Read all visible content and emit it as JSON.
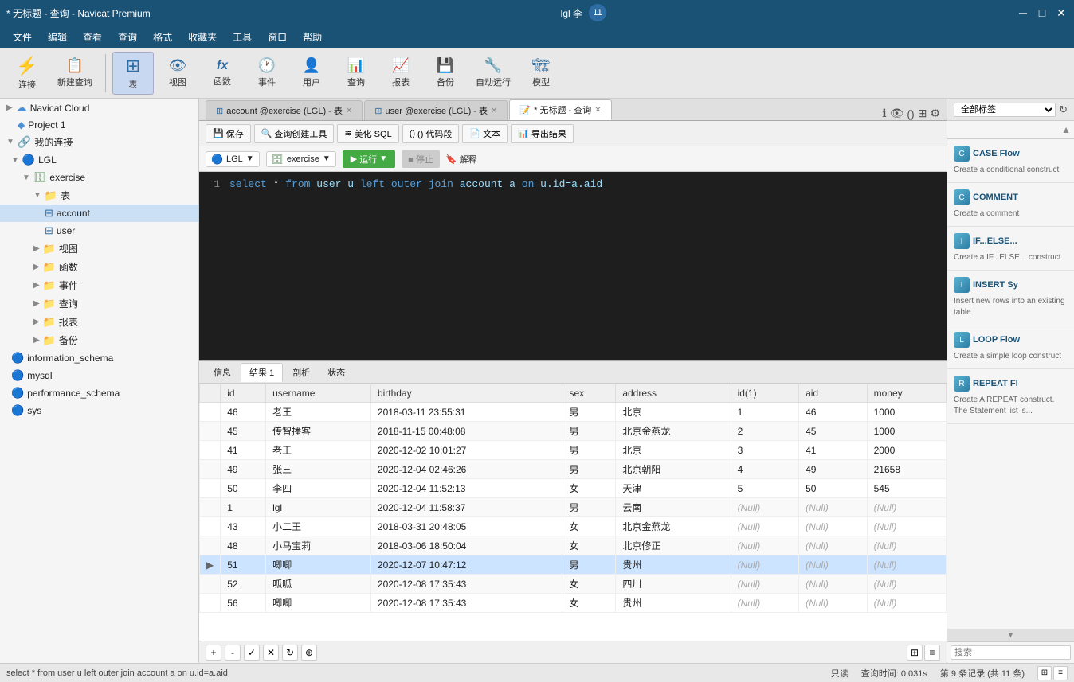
{
  "titleBar": {
    "title": "* 无标题 - 查询 - Navicat Premium",
    "minimizeBtn": "─",
    "maximizeBtn": "□",
    "closeBtn": "✕"
  },
  "menuBar": {
    "items": [
      "文件",
      "编辑",
      "查看",
      "查询",
      "格式",
      "收藏夹",
      "工具",
      "窗口",
      "帮助"
    ]
  },
  "toolbar": {
    "items": [
      {
        "id": "connect",
        "icon": "⚡",
        "label": "连接"
      },
      {
        "id": "new-query",
        "icon": "📋",
        "label": "新建查询"
      },
      {
        "id": "table",
        "icon": "⊞",
        "label": "表",
        "active": true
      },
      {
        "id": "view",
        "icon": "👁",
        "label": "视图"
      },
      {
        "id": "function",
        "icon": "fx",
        "label": "函数"
      },
      {
        "id": "event",
        "icon": "🕐",
        "label": "事件"
      },
      {
        "id": "user",
        "icon": "👤",
        "label": "用户"
      },
      {
        "id": "query",
        "icon": "📊",
        "label": "查询"
      },
      {
        "id": "report",
        "icon": "📈",
        "label": "报表"
      },
      {
        "id": "backup",
        "icon": "💾",
        "label": "备份"
      },
      {
        "id": "autorun",
        "icon": "🔧",
        "label": "自动运行"
      },
      {
        "id": "model",
        "icon": "🏗",
        "label": "模型"
      }
    ]
  },
  "sidebar": {
    "header": "Navicat Cloud",
    "items": [
      {
        "level": 0,
        "icon": "▶",
        "type": "cloud",
        "label": "Navicat Cloud",
        "expanded": true
      },
      {
        "level": 1,
        "icon": "◆",
        "type": "project",
        "label": "Project 1"
      },
      {
        "level": 0,
        "icon": "▼",
        "type": "connection",
        "label": "我的连接",
        "expanded": true
      },
      {
        "level": 1,
        "icon": "▼",
        "type": "db",
        "label": "LGL",
        "expanded": true
      },
      {
        "level": 2,
        "icon": "▼",
        "type": "db",
        "label": "exercise",
        "expanded": true
      },
      {
        "level": 3,
        "icon": "▼",
        "type": "folder",
        "label": "表",
        "expanded": true
      },
      {
        "level": 4,
        "icon": "⊞",
        "type": "table",
        "label": "account",
        "selected": true
      },
      {
        "level": 4,
        "icon": "⊞",
        "type": "table",
        "label": "user"
      },
      {
        "level": 3,
        "icon": "▶",
        "type": "folder",
        "label": "视图"
      },
      {
        "level": 3,
        "icon": "▶",
        "type": "folder",
        "label": "函数"
      },
      {
        "level": 3,
        "icon": "▶",
        "type": "folder",
        "label": "事件"
      },
      {
        "level": 3,
        "icon": "▶",
        "type": "folder",
        "label": "查询"
      },
      {
        "level": 3,
        "icon": "▶",
        "type": "folder",
        "label": "报表"
      },
      {
        "level": 3,
        "icon": "▶",
        "type": "folder",
        "label": "备份"
      },
      {
        "level": 1,
        "icon": "🔵",
        "type": "db",
        "label": "information_schema"
      },
      {
        "level": 1,
        "icon": "🔵",
        "type": "db",
        "label": "mysql"
      },
      {
        "level": 1,
        "icon": "🔵",
        "type": "db",
        "label": "performance_schema"
      },
      {
        "level": 1,
        "icon": "🔵",
        "type": "db",
        "label": "sys"
      }
    ]
  },
  "tabs": [
    {
      "id": "account-tab",
      "icon": "⊞",
      "label": "account @exercise (LGL) - 表",
      "active": false
    },
    {
      "id": "user-tab",
      "icon": "⊞",
      "label": "user @exercise (LGL) - 表",
      "active": false
    },
    {
      "id": "query-tab",
      "icon": "📝",
      "label": "* 无标题 - 查询",
      "active": true
    }
  ],
  "queryToolbar": {
    "saveBtn": "保存",
    "queryCreateBtn": "查询创建工具",
    "beautifyBtn": "美化 SQL",
    "codeBlockBtn": "() 代码段",
    "textBtn": "文本",
    "exportBtn": "导出结果"
  },
  "selectors": {
    "connection": "LGL",
    "database": "exercise",
    "runBtn": "▶ 运行",
    "stopBtn": "■ 停止",
    "explainBtn": "解释"
  },
  "sqlEditor": {
    "lineNumber": "1",
    "code": "select * from user u left outer join account a on u.id=a.aid"
  },
  "resultTabs": {
    "tabs": [
      "信息",
      "结果 1",
      "剖析",
      "状态"
    ],
    "activeTab": "结果 1"
  },
  "resultTable": {
    "columns": [
      "",
      "id",
      "username",
      "birthday",
      "sex",
      "address",
      "id(1)",
      "aid",
      "money"
    ],
    "rows": [
      {
        "indicator": "",
        "id": "46",
        "username": "老王",
        "birthday": "2018-03-11 23:55:31",
        "sex": "男",
        "address": "北京",
        "id1": "1",
        "aid": "46",
        "money": "1000"
      },
      {
        "indicator": "",
        "id": "45",
        "username": "传智播客",
        "birthday": "2018-11-15 00:48:08",
        "sex": "男",
        "address": "北京金燕龙",
        "id1": "2",
        "aid": "45",
        "money": "1000"
      },
      {
        "indicator": "",
        "id": "41",
        "username": "老王",
        "birthday": "2020-12-02 10:01:27",
        "sex": "男",
        "address": "北京",
        "id1": "3",
        "aid": "41",
        "money": "2000"
      },
      {
        "indicator": "",
        "id": "49",
        "username": "张三",
        "birthday": "2020-12-04 02:46:26",
        "sex": "男",
        "address": "北京朝阳",
        "id1": "4",
        "aid": "49",
        "money": "21658"
      },
      {
        "indicator": "",
        "id": "50",
        "username": "李四",
        "birthday": "2020-12-04 11:52:13",
        "sex": "女",
        "address": "天津",
        "id1": "5",
        "aid": "50",
        "money": "545"
      },
      {
        "indicator": "",
        "id": "1",
        "username": "lgl",
        "birthday": "2020-12-04 11:58:37",
        "sex": "男",
        "address": "云南",
        "id1": "(Null)",
        "aid": "(Null)",
        "money": "(Null)"
      },
      {
        "indicator": "",
        "id": "43",
        "username": "小二王",
        "birthday": "2018-03-31 20:48:05",
        "sex": "女",
        "address": "北京金燕龙",
        "id1": "(Null)",
        "aid": "(Null)",
        "money": "(Null)"
      },
      {
        "indicator": "",
        "id": "48",
        "username": "小马宝莉",
        "birthday": "2018-03-06 18:50:04",
        "sex": "女",
        "address": "北京修正",
        "id1": "(Null)",
        "aid": "(Null)",
        "money": "(Null)"
      },
      {
        "indicator": "▶",
        "id": "51",
        "username": "唧唧",
        "birthday": "2020-12-07 10:47:12",
        "sex": "男",
        "address": "贵州",
        "id1": "(Null)",
        "aid": "(Null)",
        "money": "(Null)"
      },
      {
        "indicator": "",
        "id": "52",
        "username": "呱呱",
        "birthday": "2020-12-08 17:35:43",
        "sex": "女",
        "address": "四川",
        "id1": "(Null)",
        "aid": "(Null)",
        "money": "(Null)"
      },
      {
        "indicator": "",
        "id": "56",
        "username": "唧唧",
        "birthday": "2020-12-08 17:35:43",
        "sex": "女",
        "address": "贵州",
        "id1": "(Null)",
        "aid": "(Null)",
        "money": "(Null)"
      }
    ]
  },
  "statusBar": {
    "sql": "select * from user u left outer join account a on u.id=a.aid",
    "mode": "只读",
    "queryTime": "查询时间: 0.031s",
    "records": "第 9 条记录 (共 11 条)"
  },
  "rightPanel": {
    "selectorLabel": "全部标签",
    "searchPlaceholder": "搜索",
    "flowItems": [
      {
        "id": "case-flow",
        "title": "CASE Flow",
        "desc": "Create a conditional construct"
      },
      {
        "id": "comment",
        "title": "COMMENT",
        "desc": "Create a comment"
      },
      {
        "id": "if-else",
        "title": "IF...ELSE...",
        "desc": "Create a IF...ELSE... construct"
      },
      {
        "id": "insert-sy",
        "title": "INSERT Sy",
        "desc": "Insert new rows into an existing table"
      },
      {
        "id": "loop-flow",
        "title": "LOOP Flow",
        "desc": "Create a simple loop construct"
      },
      {
        "id": "repeat-fl",
        "title": "REPEAT Fl",
        "desc": "Create A REPEAT construct. The Statement list is..."
      }
    ]
  },
  "account": {
    "label": "lgl 李",
    "shortLabel": "11"
  }
}
